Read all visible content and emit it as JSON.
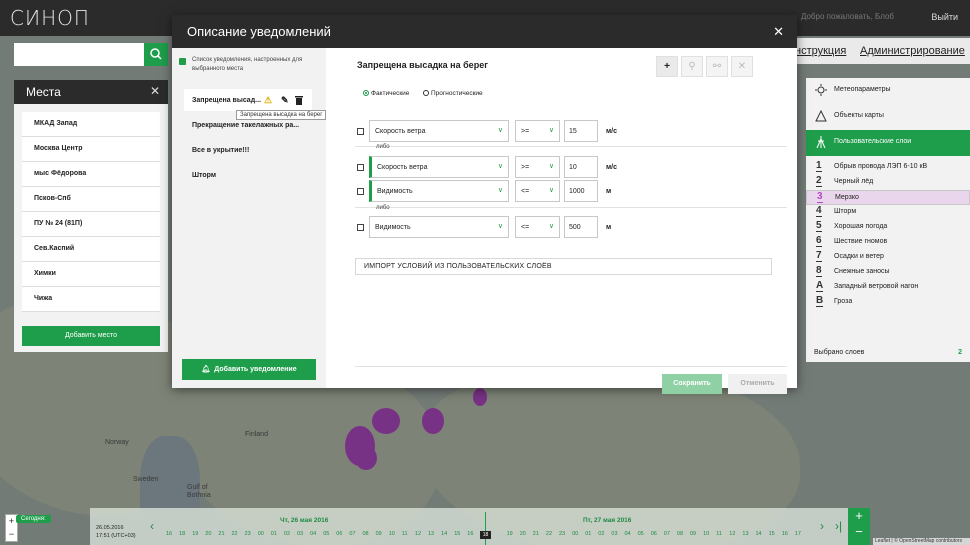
{
  "app": {
    "logo": "СИНОП",
    "exit": "Выйти",
    "greeting": "Добро пожаловать, Блоб"
  },
  "nav": {
    "instructions": "нструкция",
    "admin": "Администрирование"
  },
  "search": {
    "placeholder": ""
  },
  "places": {
    "title": "Места",
    "items": [
      "МКАД Запад",
      "Москва Центр",
      "мыс Фёдорова",
      "Псков-Спб",
      "ПУ № 24 (81П)",
      "Сев.Каспий",
      "Химки",
      "Чижа"
    ],
    "add_label": "Добавить место"
  },
  "layers": {
    "meteo": "Метеопараметры",
    "objects": "Объекты карты",
    "user_layers": "Пользовательские слои",
    "items": [
      {
        "num": "1",
        "label": "Обрыв провода ЛЭП 6-10 кВ"
      },
      {
        "num": "2",
        "label": "Черный лёд"
      },
      {
        "num": "3",
        "label": "Мерзко"
      },
      {
        "num": "4",
        "label": "Шторм"
      },
      {
        "num": "5",
        "label": "Хорошая погода"
      },
      {
        "num": "6",
        "label": "Шествие гномов"
      },
      {
        "num": "7",
        "label": "Осадки и ветер"
      },
      {
        "num": "8",
        "label": "Снежные заносы"
      },
      {
        "num": "A",
        "label": "Западный ветровой нагон"
      },
      {
        "num": "B",
        "label": "Гроза"
      }
    ],
    "selected_label": "Выбрано слоев",
    "selected_count": "2"
  },
  "dialog": {
    "title": "Описание уведомлений",
    "note": "Список уведомления, настроенных для выбранного места",
    "notifications": [
      "Запрещена высад...",
      "Прекращение такелажных ра...",
      "Все в укрытие!!!",
      "Шторм"
    ],
    "tooltip": "Запрещена высадка на берег",
    "add_label": "Добавить уведомление",
    "editor": {
      "title": "Запрещена высадка на берег",
      "radio_fact": "Фактические",
      "radio_forecast": "Прогностические",
      "or_label": "либо",
      "conditions": [
        {
          "param": "Скорость ветра",
          "op": ">=",
          "value": "15",
          "unit": "м/с"
        },
        {
          "param": "Скорость ветра",
          "op": ">=",
          "value": "10",
          "unit": "м/с"
        },
        {
          "param": "Видимость",
          "op": "<=",
          "value": "1000",
          "unit": "м"
        },
        {
          "param": "Видимость",
          "op": "<=",
          "value": "500",
          "unit": "м"
        }
      ],
      "import_label": "ИМПОРТ УСЛОВИЙ ИЗ ПОЛЬЗОВАТЕЛЬСКИХ СЛОЁВ",
      "save_label": "Сохранить",
      "cancel_label": "Отменить"
    }
  },
  "map_labels": {
    "finland": "Finland",
    "norway": "Norway",
    "sweden": "Sweden",
    "gulf": "Gulf of Bothnia"
  },
  "timeline": {
    "today_label": "Сегодня:",
    "today_date": "26.05.2016",
    "today_time": "17:51 (UTC+03)",
    "day1": "Чт, 26 мая 2016",
    "day2": "Пт, 27 мая 2016",
    "current": "18",
    "ticks": [
      "16",
      "18",
      "19",
      "20",
      "21",
      "22",
      "23",
      "00",
      "01",
      "02",
      "03",
      "04",
      "05",
      "06",
      "07",
      "08",
      "09",
      "10",
      "11",
      "12",
      "13",
      "14",
      "15",
      "16",
      "17",
      "18",
      "19",
      "20",
      "21",
      "22",
      "23",
      "00",
      "01",
      "02",
      "03",
      "04",
      "05",
      "06",
      "07",
      "08",
      "09",
      "10",
      "11",
      "12",
      "13",
      "14",
      "15",
      "16",
      "17"
    ],
    "attribution": "Leaflet | © OpenStreetMap contributors"
  }
}
